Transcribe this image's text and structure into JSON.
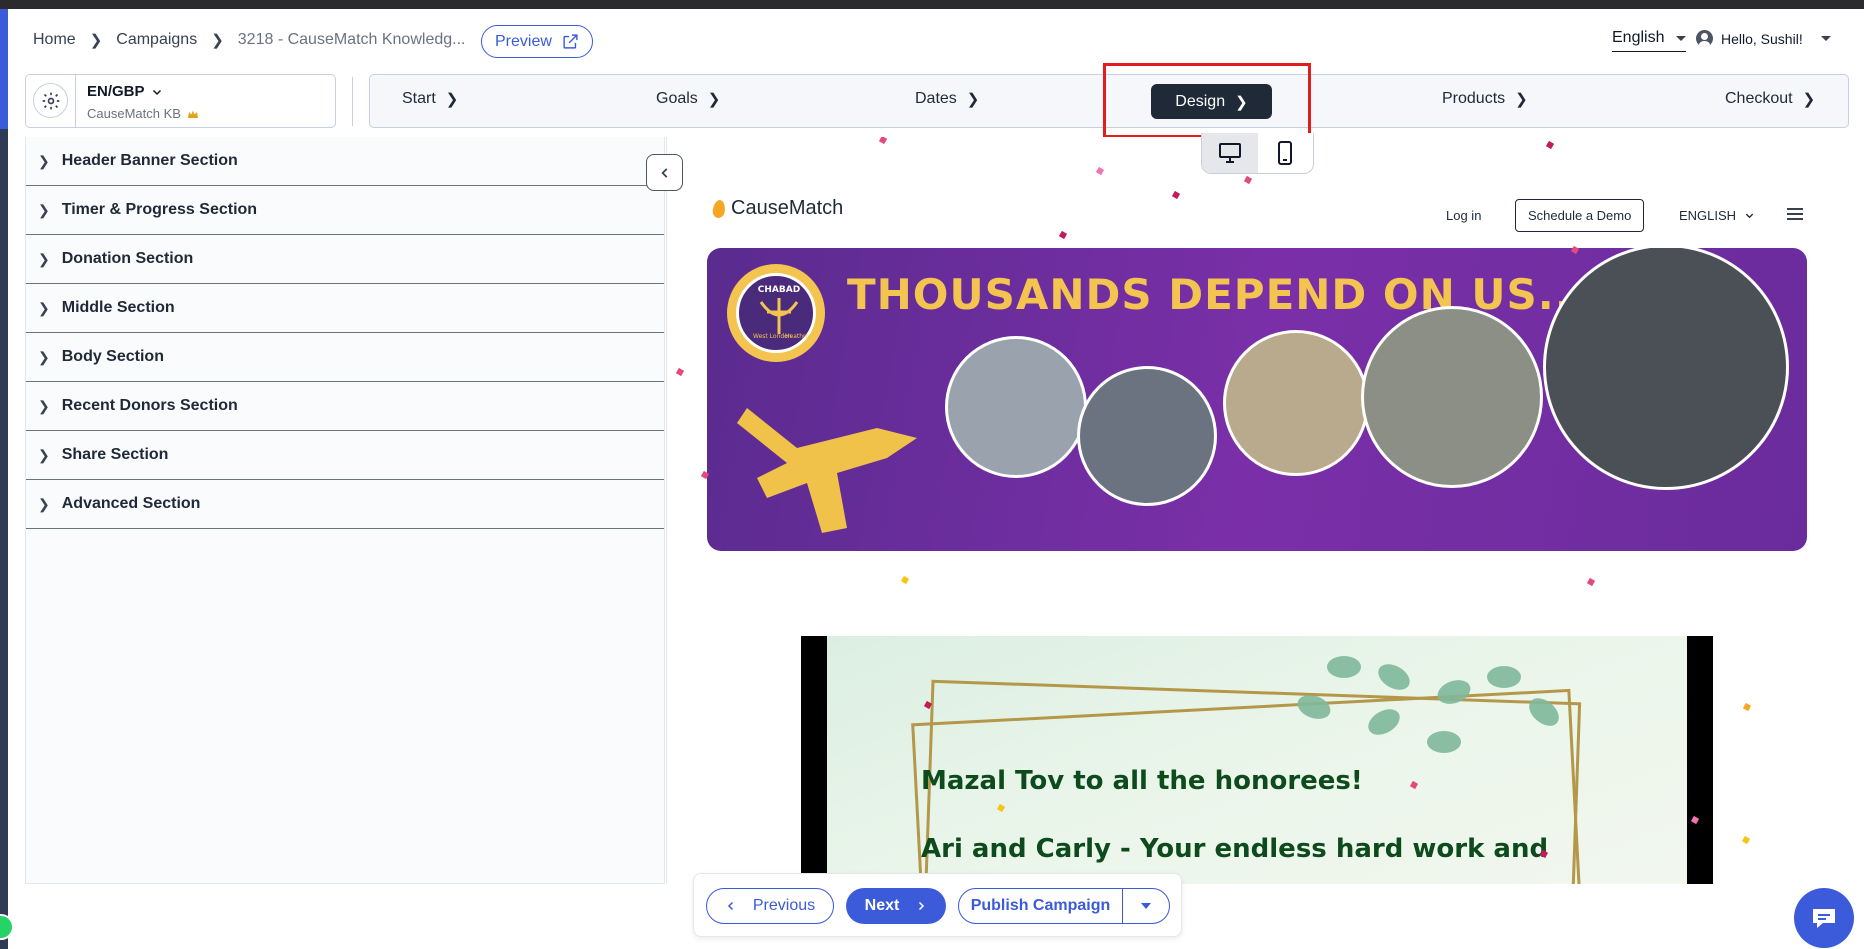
{
  "header": {
    "breadcrumbs": [
      "Home",
      "Campaigns",
      "3218 - CauseMatch Knowledg..."
    ],
    "preview_label": "Preview",
    "language": "English",
    "greeting": "Hello, Sushil!"
  },
  "currency": {
    "code": "EN/GBP",
    "org": "CauseMatch KB"
  },
  "steps": [
    "Start",
    "Goals",
    "Dates",
    "Design",
    "Products",
    "Checkout"
  ],
  "active_step": "Design",
  "sidebar": {
    "sections": [
      "Header Banner Section",
      "Timer & Progress Section",
      "Donation Section",
      "Middle Section",
      "Body Section",
      "Recent Donors Section",
      "Share Section",
      "Advanced Section"
    ]
  },
  "preview": {
    "brand": "CauseMatch",
    "login": "Log in",
    "demo": "Schedule a Demo",
    "language": "ENGLISH",
    "banner_title": "THOUSANDS DEPEND ON US...",
    "seal_top": "CHABAD",
    "seal_left": "West London",
    "seal_right": "Heathrow",
    "video_line1": "Mazal Tov to all the honorees!",
    "video_line2": "Ari and Carly - Your endless hard work and"
  },
  "footer": {
    "previous": "Previous",
    "next": "Next",
    "publish": "Publish Campaign"
  },
  "colors": {
    "accent": "#3b5bdb",
    "active_step_bg": "#1f2937",
    "highlight": "#e11d1d",
    "banner_gold": "#f3c44f",
    "banner_purple": "#6a2c9c"
  }
}
